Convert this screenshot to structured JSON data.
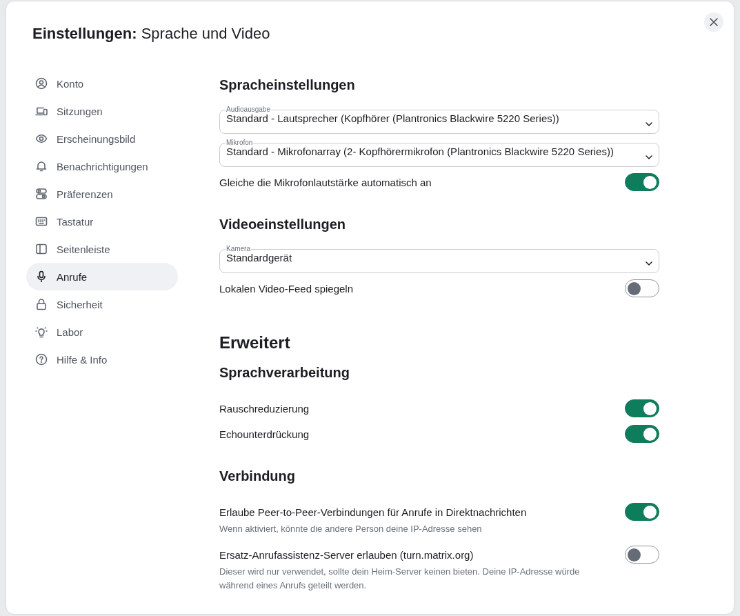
{
  "dialog": {
    "title": "**Einstellungen:** Sprache und Video"
  },
  "sidebar": {
    "items": [
      {
        "label": "Konto",
        "selected": false
      },
      {
        "label": "Sitzungen",
        "selected": false
      },
      {
        "label": "Erscheinungsbild",
        "selected": false
      },
      {
        "label": "Benachrichtigungen",
        "selected": false
      },
      {
        "label": "Präferenzen",
        "selected": false
      },
      {
        "label": "Tastatur",
        "selected": false
      },
      {
        "label": "Seitenleiste",
        "selected": false
      },
      {
        "label": "Anrufe",
        "selected": true
      },
      {
        "label": "Sicherheit",
        "selected": false
      },
      {
        "label": "Labor",
        "selected": false
      },
      {
        "label": "Hilfe & Info",
        "selected": false
      }
    ]
  },
  "content": [
    {
      "kind": "heading",
      "text": "Spracheinstellungen"
    },
    {
      "kind": "select",
      "label": "Audioausgabe",
      "value": "Standard - Lautsprecher (Kopfhörer (Plantronics Blackwire 5220 Series))"
    },
    {
      "kind": "select",
      "label": "Mikrofon",
      "value": "Standard - Mikrofonarray (2- Kopfhörermikrofon (Plantronics Blackwire 5220 Series))"
    },
    {
      "kind": "toggle",
      "label": "Gleiche die Mikrofonlautstärke automatisch an",
      "on": true
    },
    {
      "kind": "heading",
      "text": "Videoeinstellungen"
    },
    {
      "kind": "select",
      "label": "Kamera",
      "value": "Standardgerät"
    },
    {
      "kind": "toggle",
      "label": "Lokalen Video-Feed spiegeln",
      "on": false
    },
    {
      "kind": "title",
      "text": "Erweitert"
    },
    {
      "kind": "heading",
      "text": "Sprachverarbeitung"
    },
    {
      "kind": "toggle",
      "label": "Rauschreduzierung",
      "on": true
    },
    {
      "kind": "toggle",
      "label": "Echounterdrückung",
      "on": true
    },
    {
      "kind": "heading",
      "text": "Verbindung"
    },
    {
      "kind": "toggle",
      "label": "Erlaube Peer-to-Peer-Verbindungen für Anrufe in Direktnachrichten",
      "on": true,
      "description": "Wenn aktiviert, könnte die andere Person deine IP-Adresse sehen"
    },
    {
      "kind": "toggle",
      "label": "Ersatz-Anrufassistenz-Server erlauben (turn.matrix.org)",
      "on": false,
      "description": "Dieser wird nur verwendet, sollte dein Heim-Server keinen bieten. Deine IP-Adresse würde während eines Anrufs geteilt werden."
    }
  ]
}
